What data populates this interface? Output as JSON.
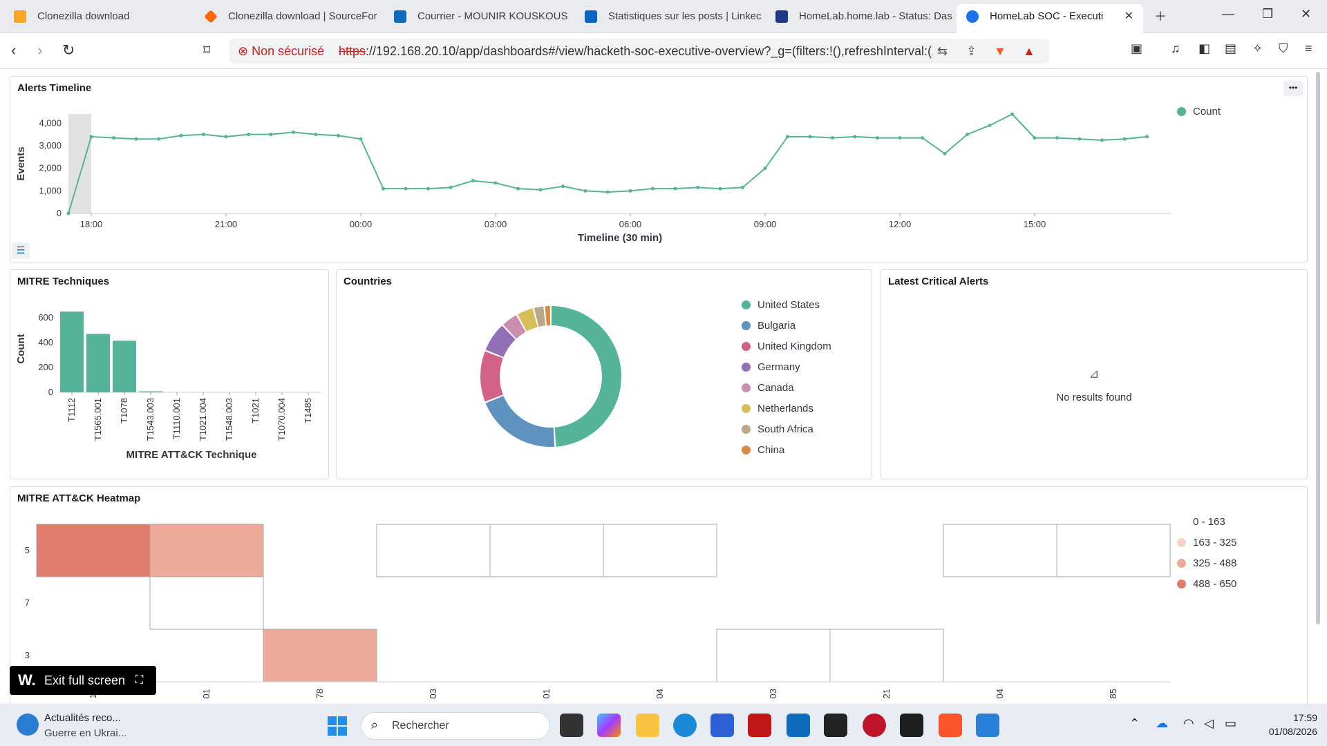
{
  "browser": {
    "tabs": [
      {
        "label": "Clonezilla download",
        "color": "#f5a623"
      },
      {
        "label": "Clonezilla download | SourceFor",
        "color": "#ff6600"
      },
      {
        "label": "Courrier - MOUNIR KOUSKOUS",
        "color": "#0f6cbd"
      },
      {
        "label": "Statistiques sur les posts | Linkec",
        "color": "#0a66c2"
      },
      {
        "label": "HomeLab.home.lab - Status: Das",
        "color": "#1e3a8a"
      },
      {
        "label": "HomeLab SOC - Executi",
        "color": "#1a73e8"
      }
    ],
    "security_label": "Non sécurisé",
    "url_scheme": "https",
    "url_rest": "://192.168.20.10/app/dashboards#/view/hacketh-soc-executive-overview?_g=(filters:!(),refreshInterval:(..."
  },
  "panels": {
    "timeline": {
      "title": "Alerts Timeline",
      "legend": "Count",
      "ylabel": "Events",
      "xlabel": "Timeline (30 min)"
    },
    "mitre_tech": {
      "title": "MITRE Techniques",
      "ylabel": "Count",
      "xlabel": "MITRE ATT&CK Technique"
    },
    "countries": {
      "title": "Countries"
    },
    "critical": {
      "title": "Latest Critical Alerts",
      "empty_text": "No results found"
    },
    "heatmap": {
      "title": "MITRE ATT&CK Heatmap"
    }
  },
  "chart_data": [
    {
      "type": "line",
      "title": "Alerts Timeline",
      "ylabel": "Events",
      "xlabel": "Timeline (30 min)",
      "series": [
        {
          "name": "Count",
          "color": "#54b399",
          "values": [
            0,
            3400,
            3350,
            3300,
            3300,
            3450,
            3500,
            3400,
            3500,
            3500,
            3600,
            3500,
            3450,
            3300,
            1100,
            1100,
            1100,
            1150,
            1450,
            1350,
            1100,
            1050,
            1200,
            1000,
            950,
            1000,
            1100,
            1100,
            1150,
            1100,
            1150,
            2000,
            3400,
            3400,
            3350,
            3400,
            3350,
            3350,
            3350,
            2650,
            3500,
            3900,
            4400,
            3350,
            3350,
            3300,
            3250,
            3300,
            3400
          ]
        }
      ],
      "x_ticks": [
        "18:00",
        "21:00",
        "00:00",
        "03:00",
        "06:00",
        "09:00",
        "12:00",
        "15:00"
      ],
      "y_ticks": [
        "0",
        "1,000",
        "2,000",
        "3,000",
        "4,000"
      ],
      "ylim": [
        0,
        4500
      ]
    },
    {
      "type": "bar",
      "title": "MITRE Techniques",
      "categories": [
        "T1112",
        "T1565.001",
        "T1078",
        "T1543.003",
        "T1110.001",
        "T1021.004",
        "T1548.003",
        "T1021",
        "T1070.004",
        "T1485"
      ],
      "values": [
        650,
        470,
        415,
        8,
        0,
        0,
        0,
        0,
        0,
        0
      ],
      "y_ticks": [
        "0",
        "200",
        "400",
        "600"
      ],
      "ylim": [
        0,
        700
      ],
      "ylabel": "Count",
      "xlabel": "MITRE ATT&CK Technique"
    },
    {
      "type": "pie",
      "title": "Countries",
      "labels": [
        "United States",
        "Bulgaria",
        "United Kingdom",
        "Germany",
        "Canada",
        "Netherlands",
        "South Africa",
        "China"
      ],
      "values": [
        49,
        20,
        12,
        7,
        4,
        4,
        2.5,
        1.5
      ],
      "colors": [
        "#54b399",
        "#6092c0",
        "#d36086",
        "#9170b8",
        "#ca8eae",
        "#d6bf57",
        "#b9a888",
        "#da8b45"
      ]
    },
    {
      "type": "heatmap",
      "title": "MITRE ATT&CK Heatmap",
      "y_ticks": [
        "5",
        "7",
        "3"
      ],
      "x_ticks": [
        "12",
        "01",
        "78",
        "03",
        "01",
        "04",
        "03",
        "21",
        "04",
        "85"
      ],
      "legend": [
        "0 - 163",
        "163 - 325",
        "325 - 488",
        "488 - 650"
      ],
      "legend_colors": [
        "#ffffff",
        "#f8d2c8",
        "#eeaa98",
        "#e07c6b"
      ]
    }
  ],
  "overlay": {
    "exit_fullscreen": "Exit full screen"
  },
  "taskbar": {
    "news_title": "Actualités reco...",
    "news_sub": "Guerre en Ukrai...",
    "search_placeholder": "Rechercher",
    "time": "17:59",
    "date": "01/08/2026"
  }
}
